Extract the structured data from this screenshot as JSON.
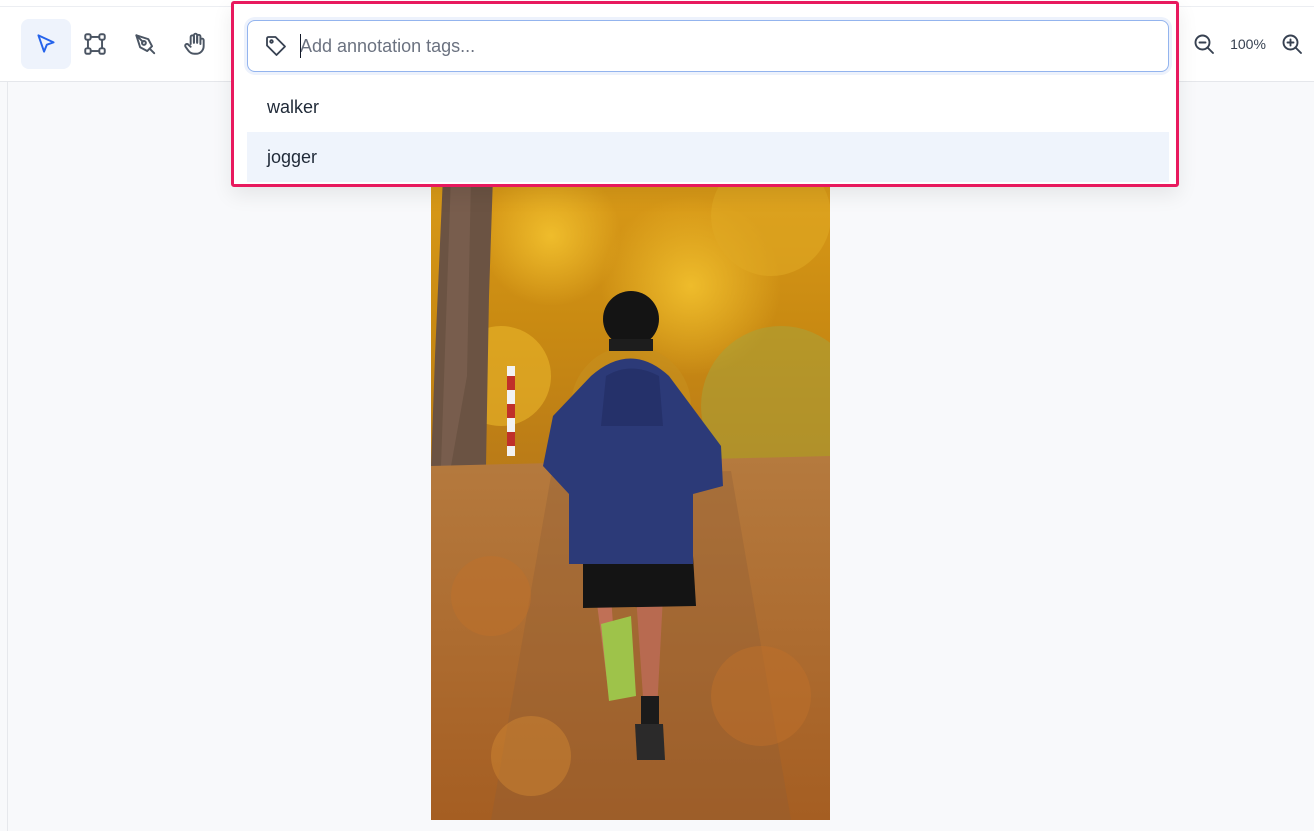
{
  "toolbar": {
    "tools": [
      {
        "name": "select-tool",
        "icon": "pointer-arrow-icon",
        "active": true
      },
      {
        "name": "bounding-box-tool",
        "icon": "bounding-box-icon",
        "active": false
      },
      {
        "name": "pen-tool",
        "icon": "pen-nib-icon",
        "active": false
      },
      {
        "name": "pan-tool",
        "icon": "hand-icon",
        "active": false
      }
    ],
    "zoom_out_icon": "zoom-out-icon",
    "zoom_in_icon": "zoom-in-icon",
    "zoom_level": "100%"
  },
  "tag_panel": {
    "input_icon": "tag-icon",
    "placeholder": "Add annotation tags...",
    "value": "",
    "options": [
      "walker",
      "jogger"
    ],
    "highlighted_option": "jogger",
    "highlight_color": "#e8195e"
  },
  "canvas": {
    "image_icon": "photo-image"
  },
  "colors": {
    "accent": "#2563eb",
    "active_tool_bg": "#eef3fc",
    "option_hover_bg": "#eff4fc",
    "canvas_bg": "#f8f9fb"
  }
}
